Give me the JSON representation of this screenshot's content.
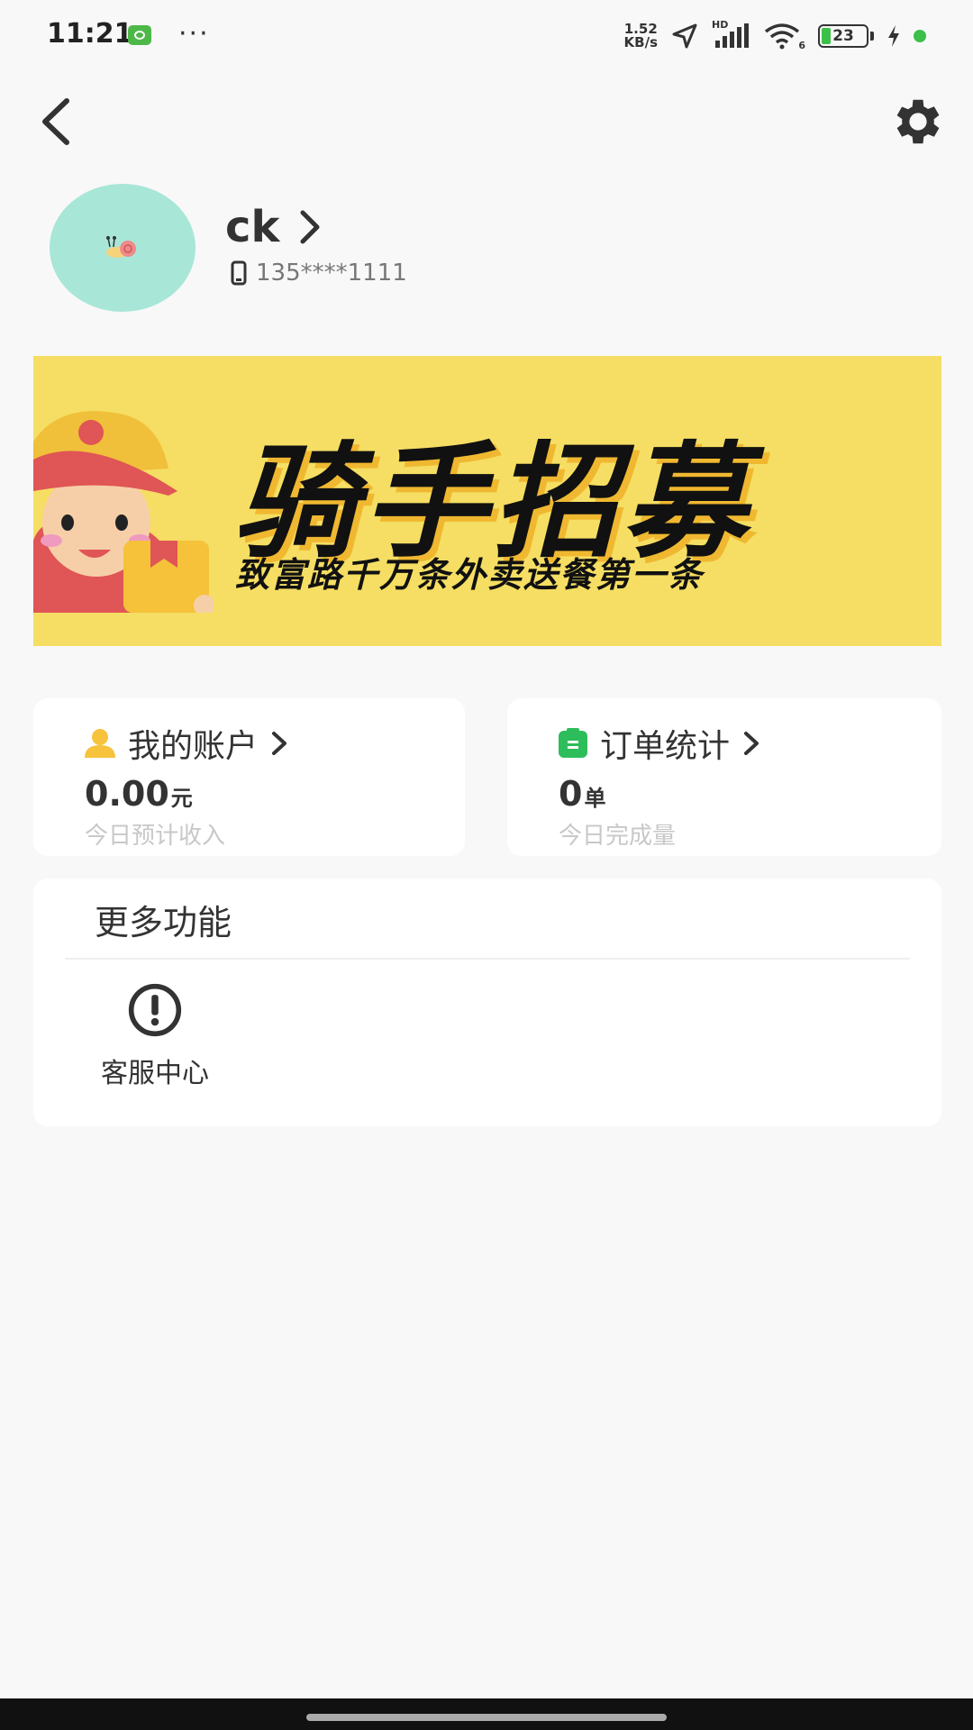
{
  "status_bar": {
    "time": "11:21",
    "dots": "···",
    "net_speed_value": "1.52",
    "net_speed_unit": "KB/s",
    "hd_label": "HD",
    "wifi_label": "6",
    "battery": "23",
    "colors": {
      "battery": "#3cc04a",
      "app_icon": "#4db848"
    }
  },
  "nav": {
    "back_icon": "chevron-left-icon",
    "settings_icon": "gear-icon"
  },
  "profile": {
    "name": "ck",
    "phone": "135****1111",
    "avatar_bg": "#a8e6d8"
  },
  "banner": {
    "title": "骑手招募",
    "subtitle": "致富路千万条外卖送餐第一条",
    "bg": "#f5de63"
  },
  "cards": {
    "account": {
      "title": "我的账户",
      "value": "0.00",
      "unit": "元",
      "caption": "今日预计收入",
      "icon": "user-icon",
      "icon_color": "#f7c23c"
    },
    "orders": {
      "title": "订单统计",
      "value": "0",
      "unit": "单",
      "caption": "今日完成量",
      "icon": "clipboard-icon",
      "icon_color": "#2dbd5a"
    }
  },
  "more": {
    "title": "更多功能",
    "items": [
      {
        "label": "客服中心",
        "icon": "alert-circle-icon"
      }
    ]
  }
}
